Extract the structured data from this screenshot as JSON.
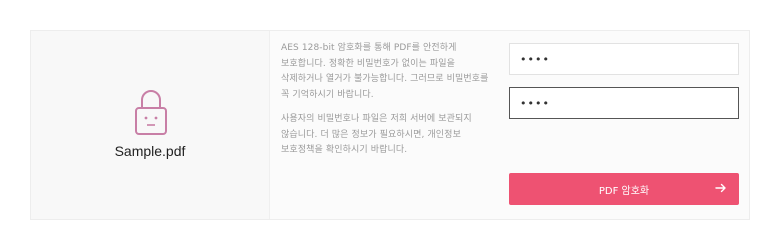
{
  "file": {
    "name": "Sample.pdf",
    "icon": "locked-file-icon",
    "icon_color": "#c87fa6"
  },
  "info": {
    "paragraph1": "AES 128-bit 암호화를 통해 PDF를 안전하게 보호합니다. 정확한 비밀번호가 없이는 파일을 삭제하거나 열거가 불가능합니다. 그러므로 비밀번호를 꼭 기억하시기 바랍니다.",
    "paragraph2": "사용자의 비밀번호나 파일은 저희 서버에 보관되지 않습니다. 더 많은 정보가 필요하시면, 개인정보 보호정책을 확인하시기 바랍니다."
  },
  "form": {
    "password_value": "••••",
    "confirm_value": "••••"
  },
  "action": {
    "encrypt_label": "PDF 암호화",
    "arrow_icon": "arrow-right-icon",
    "button_color": "#ee5272"
  }
}
